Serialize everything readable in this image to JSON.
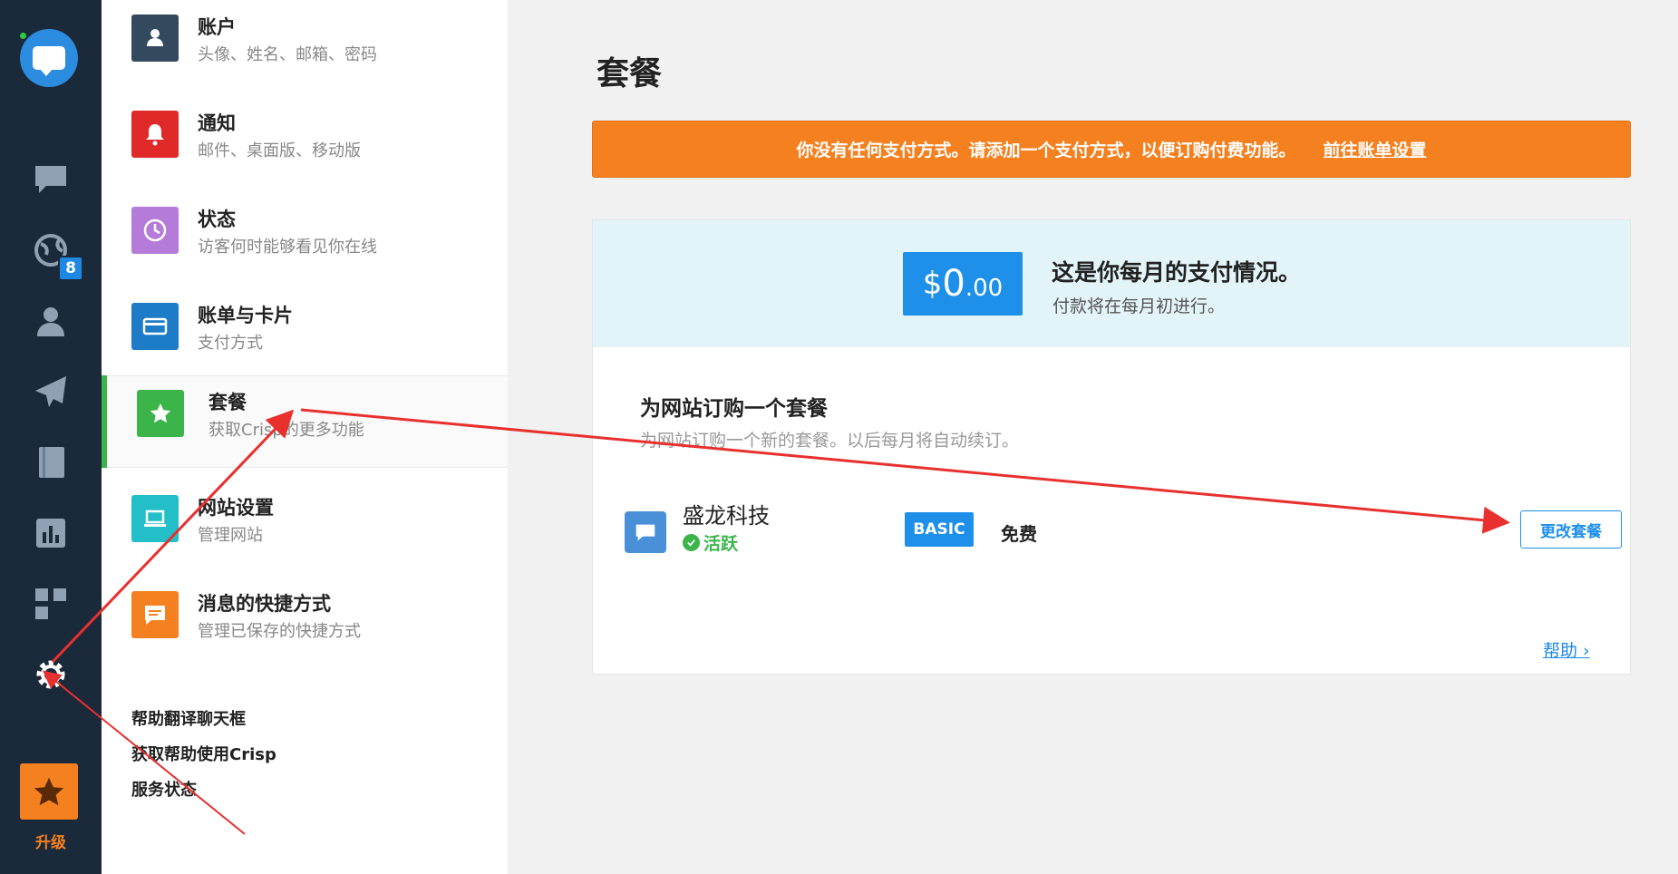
{
  "rail": {
    "badge_count": "8",
    "upgrade_label": "升级"
  },
  "settings": {
    "items": [
      {
        "title": "账户",
        "sub": "头像、姓名、邮箱、密码",
        "icon": "user-icon",
        "color": "#34495e"
      },
      {
        "title": "通知",
        "sub": "邮件、桌面版、移动版",
        "icon": "bell-icon",
        "color": "#e02a2a"
      },
      {
        "title": "状态",
        "sub": "访客何时能够看见你在线",
        "icon": "clock-icon",
        "color": "#b57bd9"
      },
      {
        "title": "账单与卡片",
        "sub": "支付方式",
        "icon": "credit-card-icon",
        "color": "#1e7bc7"
      },
      {
        "title": "套餐",
        "sub": "获取Crisp的更多功能",
        "icon": "star-icon",
        "color": "#3bb54a"
      },
      {
        "title": "网站设置",
        "sub": "管理网站",
        "icon": "laptop-icon",
        "color": "#22bfc9"
      },
      {
        "title": "消息的快捷方式",
        "sub": "管理已保存的快捷方式",
        "icon": "message-icon",
        "color": "#f5801f"
      }
    ],
    "footer_links": [
      "帮助翻译聊天框",
      "获取帮助使用Crisp",
      "服务状态"
    ]
  },
  "main": {
    "title": "套餐",
    "alert": {
      "text": "你没有任何支付方式。请添加一个支付方式，以便订购付费功能。",
      "link": "前往账单设置"
    },
    "payment": {
      "currency": "$",
      "amount": "0",
      "cents": ".00",
      "title": "这是你每月的支付情况。",
      "sub": "付款将在每月初进行。"
    },
    "plans": {
      "title": "为网站订购一个套餐",
      "sub": "为网站订购一个新的套餐。以后每月将自动续订。",
      "site_name": "盛龙科技",
      "site_status": "活跃",
      "plan_badge": "BASIC",
      "plan_price": "免费",
      "change_button": "更改套餐",
      "help": "帮助 ›"
    }
  },
  "colors": {
    "rail_bg": "#1b2a3a",
    "accent_orange": "#f5801f",
    "accent_blue": "#1e90ea",
    "accent_green": "#3bb54a",
    "annotation_red": "#e8302e"
  }
}
